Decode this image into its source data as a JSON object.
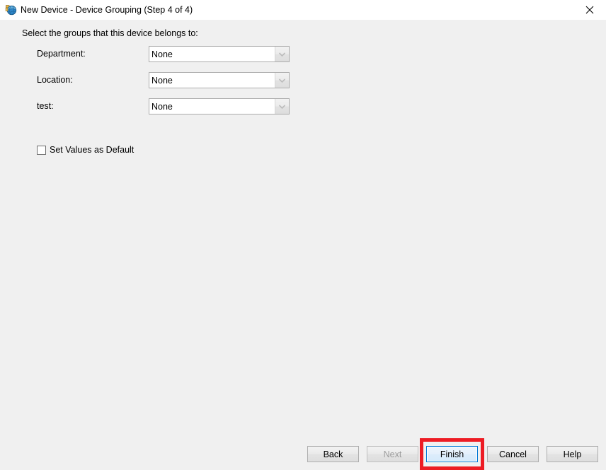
{
  "window": {
    "title": "New Device - Device Grouping (Step 4 of 4)",
    "icon": "globe-device-icon",
    "close_label": "✕"
  },
  "content": {
    "intro": "Select the groups that this device belongs to:",
    "rows": [
      {
        "label": "Department:",
        "value": "None",
        "arrow_icon": "chevron-down-icon"
      },
      {
        "label": "Location:",
        "value": "None",
        "arrow_icon": "chevron-down-icon"
      },
      {
        "label": "test:",
        "value": "None",
        "arrow_icon": "chevron-down-icon"
      }
    ],
    "checkbox": {
      "label": "Set Values as Default",
      "checked": false
    }
  },
  "footer": {
    "buttons": [
      {
        "label": "Back",
        "state": "enabled"
      },
      {
        "label": "Next",
        "state": "disabled"
      },
      {
        "label": "Finish",
        "state": "focused"
      },
      {
        "label": "Cancel",
        "state": "enabled"
      },
      {
        "label": "Help",
        "state": "enabled"
      }
    ]
  },
  "annotation": {
    "target": "Finish",
    "color": "#ed1c24"
  },
  "colors": {
    "window_background": "#f0f0f0",
    "titlebar_background": "#ffffff",
    "field_background": "#ffffff",
    "field_border": "#acacac",
    "button_border": "#adadad",
    "focus_border": "#0078d7",
    "disabled_text": "#9d9d9d",
    "highlight": "#ed1c24"
  }
}
